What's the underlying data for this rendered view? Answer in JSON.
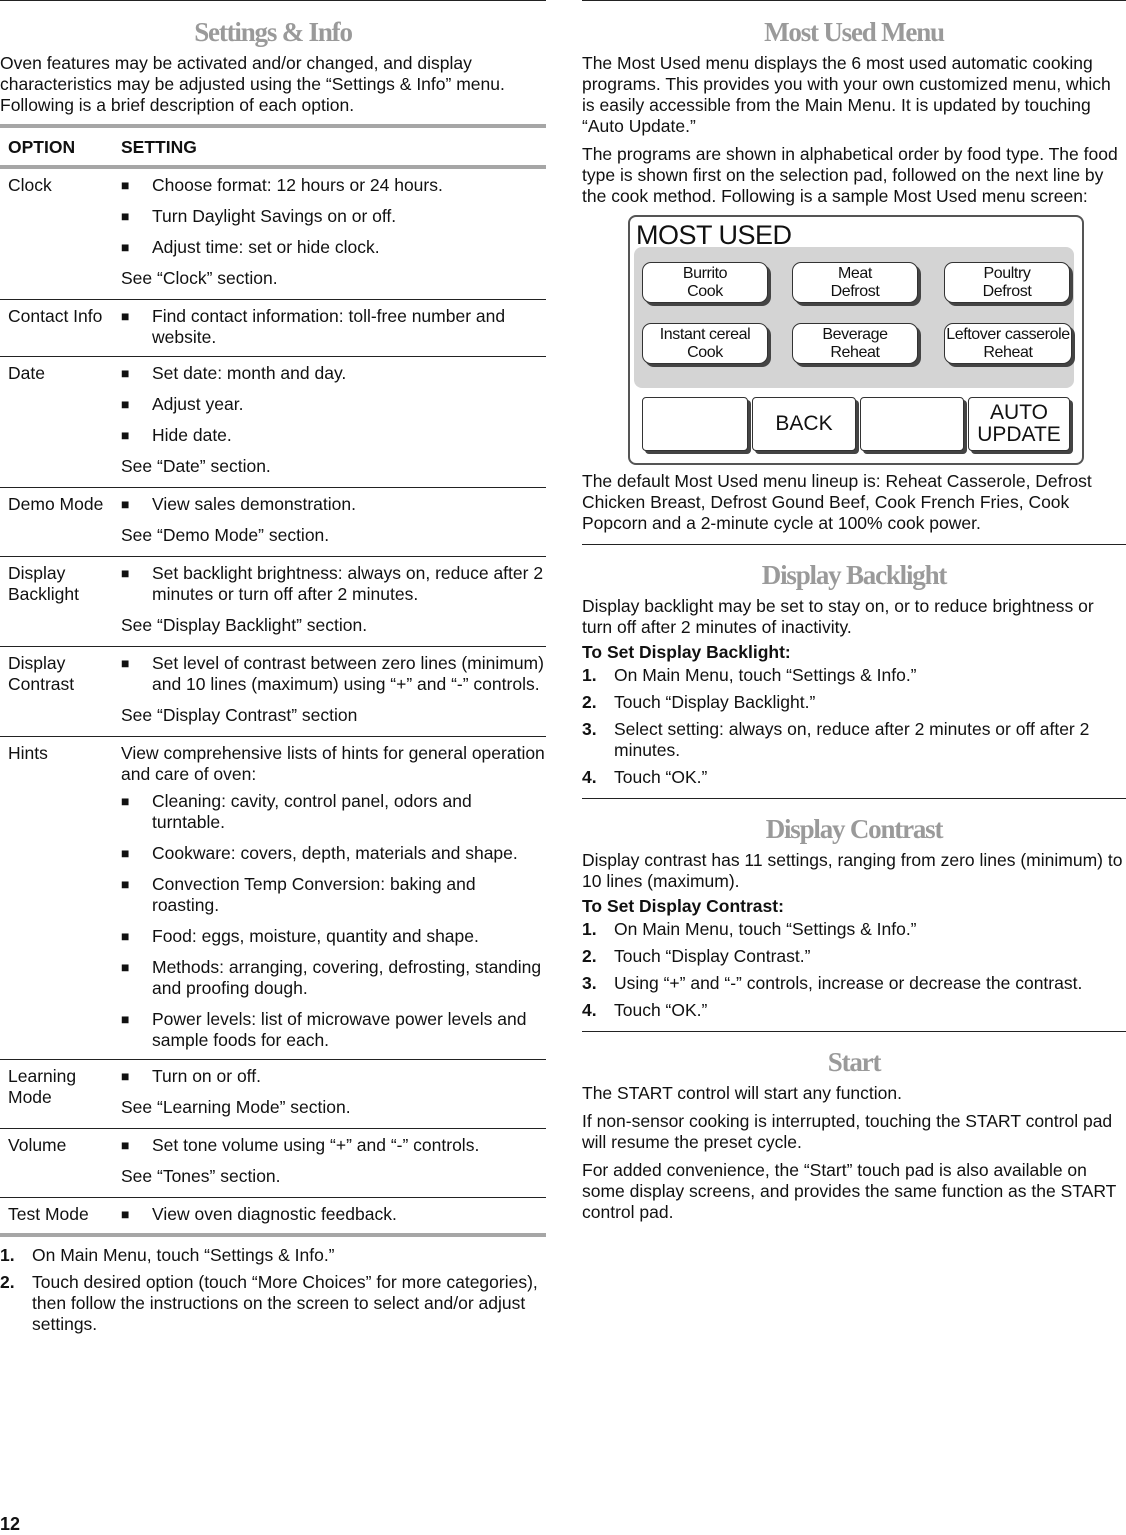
{
  "page_number": "12",
  "settings": {
    "title": "Settings & Info",
    "intro": "Oven features may be activated and/or changed, and display characteristics may be adjusted using the “Settings & Info” menu. Following is a brief description of each option.",
    "table": {
      "headers": [
        "OPTION",
        "SETTING"
      ],
      "rows": [
        {
          "option": "Clock",
          "bullets": [
            "Choose format: 12 hours or 24 hours.",
            "Turn Daylight Savings on or off.",
            "Adjust time: set or hide clock."
          ],
          "intro": "",
          "see": "See “Clock” section."
        },
        {
          "option": "Contact Info",
          "bullets": [
            "Find contact information: toll-free number and website."
          ],
          "intro": "",
          "see": ""
        },
        {
          "option": "Date",
          "bullets": [
            "Set date: month and day.",
            "Adjust year.",
            "Hide date."
          ],
          "intro": "",
          "see": "See “Date” section."
        },
        {
          "option": "Demo Mode",
          "bullets": [
            "View sales demonstration."
          ],
          "intro": "",
          "see": "See “Demo Mode” section."
        },
        {
          "option": "Display Backlight",
          "bullets": [
            "Set backlight brightness: always on, reduce after 2 minutes or turn off after 2 minutes."
          ],
          "intro": "",
          "see": "See “Display Backlight” section."
        },
        {
          "option": "Display Contrast",
          "bullets": [
            "Set level of contrast between zero lines (minimum) and 10 lines (maximum) using “+” and “-” controls."
          ],
          "intro": "",
          "see": "See “Display Contrast” section"
        },
        {
          "option": "Hints",
          "intro": "View comprehensive lists of hints for general operation and care of oven:",
          "bullets": [
            "Cleaning: cavity, control panel, odors and turntable.",
            "Cookware: covers, depth, materials and shape.",
            "Convection Temp Conversion: baking and roasting.",
            "Food: eggs, moisture, quantity and shape.",
            "Methods: arranging, covering, defrosting, standing and proofing dough.",
            "Power levels: list of microwave power levels and sample foods for each."
          ],
          "see": ""
        },
        {
          "option": "Learning Mode",
          "bullets": [
            "Turn on or off."
          ],
          "intro": "",
          "see": "See “Learning Mode” section."
        },
        {
          "option": "Volume",
          "bullets": [
            "Set tone volume using “+” and “-” controls."
          ],
          "intro": "",
          "see": "See “Tones” section."
        },
        {
          "option": "Test Mode",
          "bullets": [
            "View oven diagnostic feedback."
          ],
          "intro": "",
          "see": ""
        }
      ]
    },
    "steps": [
      {
        "num": "1.",
        "text": "On Main Menu, touch “Settings & Info.”"
      },
      {
        "num": "2.",
        "text": "Touch desired option (touch “More Choices” for more categories), then follow the instructions on the screen to select and/or adjust settings."
      }
    ]
  },
  "most_used": {
    "title": "Most Used Menu",
    "para1": "The Most Used menu displays the 6 most used automatic cooking programs. This provides you with your own customized menu, which is easily accessible from the Main Menu. It is updated by touching “Auto Update.”",
    "para2": "The programs are shown in alphabetical order by food type. The food type is shown first on the selection pad, followed on the next line by the cook method. Following is a sample Most Used menu screen:",
    "screen": {
      "title": "MOST USED",
      "buttons": [
        {
          "line1": "Burrito",
          "line2": "Cook"
        },
        {
          "line1": "Meat",
          "line2": "Defrost"
        },
        {
          "line1": "Poultry",
          "line2": "Defrost"
        },
        {
          "line1": "Instant cereal",
          "line2": "Cook"
        },
        {
          "line1": "Beverage",
          "line2": "Reheat"
        },
        {
          "line1": "Leftover casserole",
          "line2": "Reheat"
        }
      ],
      "bottom": [
        "",
        "BACK",
        "",
        "AUTO UPDATE"
      ]
    },
    "para3": "The default Most Used menu lineup is: Reheat Casserole, Defrost Chicken Breast, Defrost Gound Beef, Cook French Fries, Cook Popcorn and a 2-minute cycle at 100% cook power."
  },
  "backlight": {
    "title": "Display Backlight",
    "intro": "Display backlight may be set to stay on, or to reduce brightness or turn off after 2 minutes of inactivity.",
    "subhead": "To Set Display Backlight:",
    "steps": [
      {
        "num": "1.",
        "text": "On Main Menu, touch “Settings & Info.”"
      },
      {
        "num": "2.",
        "text": "Touch “Display Backlight.”"
      },
      {
        "num": "3.",
        "text": "Select setting: always on, reduce after 2 minutes or off after 2 minutes."
      },
      {
        "num": "4.",
        "text": "Touch “OK.”"
      }
    ]
  },
  "contrast": {
    "title": "Display Contrast",
    "intro": "Display contrast has 11 settings, ranging from zero lines (minimum) to 10 lines (maximum).",
    "subhead": "To Set Display Contrast:",
    "steps": [
      {
        "num": "1.",
        "text": "On Main Menu, touch “Settings & Info.”"
      },
      {
        "num": "2.",
        "text": "Touch “Display Contrast.”"
      },
      {
        "num": "3.",
        "text": "Using “+” and “-” controls, increase or decrease the contrast."
      },
      {
        "num": "4.",
        "text": "Touch “OK.”"
      }
    ]
  },
  "start": {
    "title": "Start",
    "paras": [
      "The START control will start any function.",
      "If non-sensor cooking is interrupted, touching the START control pad will resume the preset cycle.",
      "For added convenience, the “Start” touch pad is also available on some display screens, and provides the same function as the START control pad."
    ]
  }
}
